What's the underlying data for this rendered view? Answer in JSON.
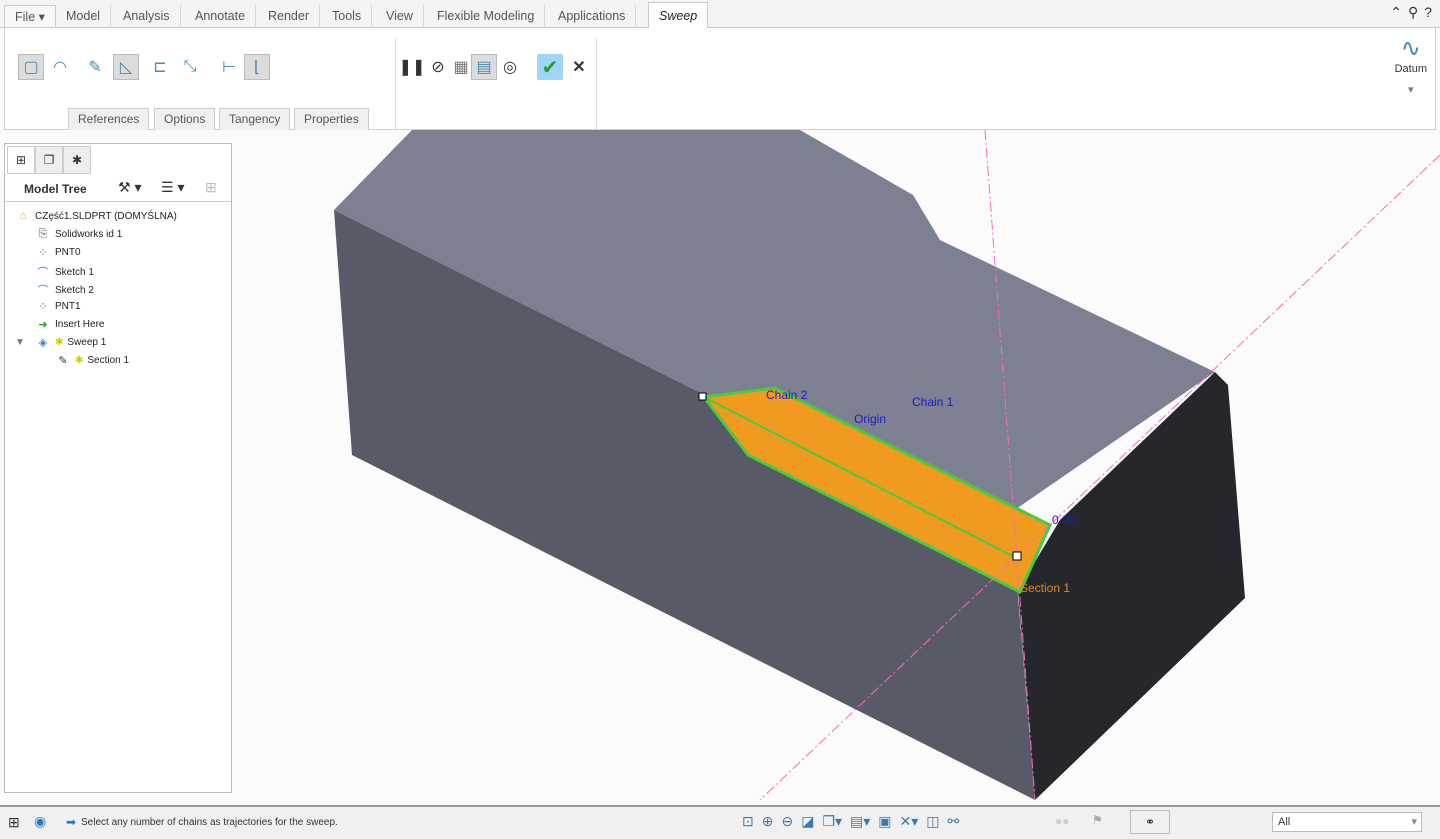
{
  "menu": {
    "file": "File",
    "tabs": [
      "Model",
      "Analysis",
      "Annotate",
      "Render",
      "Tools",
      "View",
      "Flexible Modeling",
      "Applications"
    ],
    "active_tab": "Sweep"
  },
  "ribbon": {
    "subtabs": [
      "References",
      "Options",
      "Tangency",
      "Properties"
    ],
    "datum_label": "Datum"
  },
  "model_tree": {
    "title": "Model Tree",
    "items": [
      {
        "label": "CZęść1.SLDPRT (DOMYŚLNA)",
        "icon": "part-icon"
      },
      {
        "label": "Solidworks id 1",
        "icon": "import-feature-icon"
      },
      {
        "label": "PNT0",
        "icon": "datum-point-icon"
      },
      {
        "label": "Sketch 1",
        "icon": "sketch-icon"
      },
      {
        "label": "Sketch 2",
        "icon": "sketch-icon"
      },
      {
        "label": "PNT1",
        "icon": "datum-point-icon"
      },
      {
        "label": "Insert Here",
        "icon": "insert-arrow-icon"
      },
      {
        "label": "Sweep 1",
        "icon": "sweep-icon"
      },
      {
        "label": "Section 1",
        "icon": "section-sketch-icon"
      }
    ]
  },
  "viewport": {
    "labels": {
      "chain2": "Chain 2",
      "origin": "Origin",
      "chain1": "Chain 1",
      "dim": "0.00",
      "section": "Section 1"
    },
    "colors": {
      "sweep": "#f09a20",
      "chain": "#44cc44",
      "label_blue": "#1a1acc",
      "label_orange": "#e08a10"
    }
  },
  "status": {
    "message": "Select any number of chains as trajectories for the sweep.",
    "filter": "All"
  }
}
